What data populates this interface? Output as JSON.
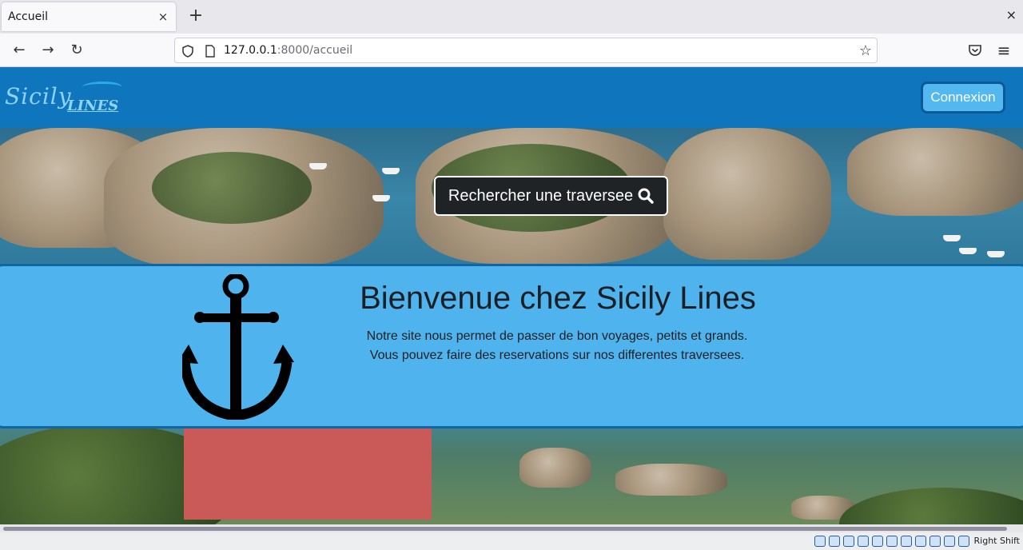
{
  "browser": {
    "tab_title": "Accueil",
    "tab_close": "×",
    "new_tab": "+",
    "window_close": "×",
    "url_host": "127.0.0.1",
    "url_rest": ":8000/accueil",
    "nav": {
      "back": "←",
      "forward": "→",
      "reload": "↻"
    },
    "bookmark_star": "☆",
    "menu": "≡"
  },
  "site": {
    "logo_word1": "Sicily",
    "logo_word2": "LINES",
    "login_button": "Connexion",
    "search_button": "Rechercher une traversee",
    "welcome_title": "Bienvenue chez Sicily Lines",
    "welcome_line1": "Notre site nous permet de passer de bon voyages, petits et grands.",
    "welcome_line2": "Vous pouvez faire des reservations sur nos differentes traversees."
  },
  "status": {
    "right_text": "Right Shift"
  },
  "colors": {
    "header": "#0f75bc",
    "welcome_bg": "#4fb3ee",
    "button_dark": "#1f2326",
    "login_bg": "#53b7f0"
  }
}
